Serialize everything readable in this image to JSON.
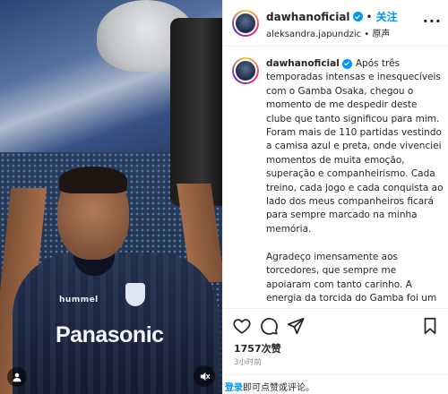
{
  "media": {
    "sponsor": "Panasonic",
    "crest_text": "hummel"
  },
  "header": {
    "username": "dawhanoficial",
    "follow_label": "关注",
    "audio_owner": "aleksandra.japundzic",
    "audio_type": "原声",
    "separator": "•",
    "more_label": "···"
  },
  "caption": {
    "username": "dawhanoficial",
    "text": "Após três temporadas intensas e inesquecíveis com o Gamba Osaka, chegou o momento de me despedir deste clube que tanto significou para mim. Foram mais de 110 partidas vestindo a camisa azul e preta, onde vivenciei momentos de muita emoção, superação e companheirismo. Cada treino, cada jogo e cada conquista ao lado dos meus companheiros ficará para sempre marcado na minha memória.\n\nAgradeço imensamente aos torcedores, que sempre me apoiaram com tanto carinho. A energia da torcida do Gamba foi um combustível para mim. Foi uma honra poder representar essa"
  },
  "stats": {
    "likes": "1757次赞",
    "time_ago": "3小时前"
  },
  "comment_bar": {
    "login_label": "登录",
    "rest_label": "即可点赞或评论。"
  },
  "colors": {
    "link_blue": "#0095f6",
    "text": "#262626",
    "muted": "#8e8e8e"
  }
}
